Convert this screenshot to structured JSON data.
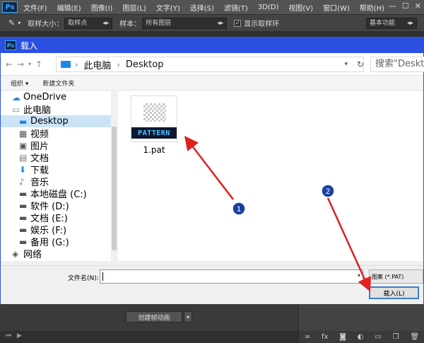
{
  "ps": {
    "logo": "Ps",
    "menu": [
      "文件(F)",
      "编辑(E)",
      "图像(I)",
      "图层(L)",
      "文字(Y)",
      "选择(S)",
      "滤镜(T)",
      "3D(D)",
      "视图(V)",
      "窗口(W)",
      "帮助(H)"
    ],
    "window_controls": {
      "minimize": "—",
      "maximize": "☐",
      "close": "✕"
    },
    "options": {
      "sample_size_label": "取样大小：",
      "sample_size_value": "取样点",
      "sample_label": "样本：",
      "sample_value": "所有图层",
      "show_ring_label": "显示取样环",
      "workspace_value": "基本功能"
    },
    "timeline_button": "创建帧动画"
  },
  "dialog": {
    "title": "载入",
    "path": [
      "此电脑",
      "Desktop"
    ],
    "search_placeholder": "搜索\"Desktop\"",
    "toolbar": {
      "organize": "组织 ▾",
      "new_folder": "新建文件夹"
    },
    "sidebar": [
      {
        "label": "OneDrive",
        "icon": "cloud-icon",
        "color": "#1e88e5"
      },
      {
        "label": "此电脑",
        "icon": "computer-icon",
        "color": "#4a90d9"
      },
      {
        "label": "Desktop",
        "icon": "desktop-icon",
        "color": "#1e88e5",
        "selected": true
      },
      {
        "label": "视频",
        "icon": "video-icon",
        "color": "#555555"
      },
      {
        "label": "图片",
        "icon": "pictures-icon",
        "color": "#555555"
      },
      {
        "label": "文档",
        "icon": "documents-icon",
        "color": "#777777"
      },
      {
        "label": "下载",
        "icon": "download-icon",
        "color": "#1e88e5"
      },
      {
        "label": "音乐",
        "icon": "music-icon",
        "color": "#1e88e5"
      },
      {
        "label": "本地磁盘 (C:)",
        "icon": "drive-icon",
        "color": "#555555"
      },
      {
        "label": "软件 (D:)",
        "icon": "drive-icon",
        "color": "#555555"
      },
      {
        "label": "文档 (E:)",
        "icon": "drive-icon",
        "color": "#555555"
      },
      {
        "label": "娱乐 (F:)",
        "icon": "drive-icon",
        "color": "#555555"
      },
      {
        "label": "备用 (G:)",
        "icon": "drive-icon",
        "color": "#555555"
      },
      {
        "label": "网络",
        "icon": "network-icon",
        "color": "#555555"
      }
    ],
    "file": {
      "thumb_label": "PATTERN",
      "name": "1.pat"
    },
    "filename_label": "文件名(N):",
    "filename_value": "",
    "file_type": "图案 (*.PAT)",
    "load_button": "载入(L)"
  },
  "annotations": {
    "marker_1": "1",
    "marker_2": "2",
    "arrow_color": "#e02020"
  }
}
